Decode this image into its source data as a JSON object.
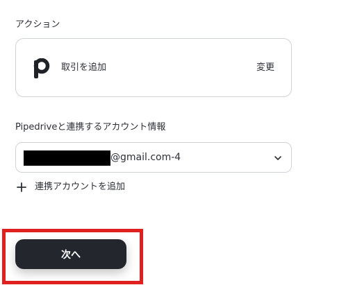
{
  "action_section": {
    "label": "アクション",
    "app_icon": "pipedrive-logo-icon",
    "action_name": "取引を追加",
    "change_label": "変更"
  },
  "account_section": {
    "label": "Pipedriveと連携するアカウント情報",
    "selected_account_suffix": "@gmail.com-4",
    "dropdown_icon": "chevron-down-icon",
    "add_account_label": "連携アカウントを追加",
    "add_icon": "plus-icon"
  },
  "footer": {
    "next_label": "次へ"
  },
  "colors": {
    "text": "#2b2f36",
    "border": "#cfd3d8",
    "button_bg": "#23262d",
    "highlight": "#e0201f",
    "redaction": "#000000"
  }
}
